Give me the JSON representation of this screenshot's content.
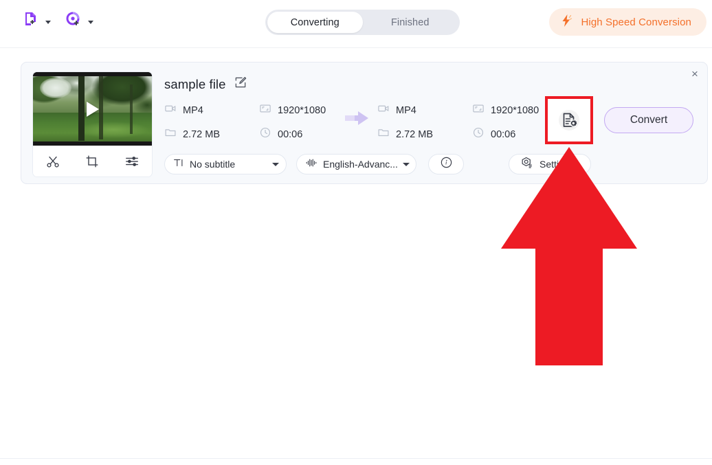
{
  "header": {
    "add_file_icon": "add-file-icon",
    "add_record_icon": "add-record-icon",
    "tabs": [
      {
        "label": "Converting",
        "active": true
      },
      {
        "label": "Finished",
        "active": false
      }
    ],
    "high_speed": {
      "label": "High Speed Conversion",
      "icon": "lightning-bolt-icon",
      "color": "#f4702a",
      "bg": "#fdeee4"
    }
  },
  "card": {
    "close_label": "×",
    "file_name": "sample file",
    "edit_icon": "edit-pencil-icon",
    "thumbnail": {
      "play_icon": "play-icon",
      "tools": [
        {
          "name": "trim-scissors-icon",
          "label": "Trim"
        },
        {
          "name": "crop-icon",
          "label": "Crop"
        },
        {
          "name": "effects-sliders-icon",
          "label": "Effects"
        }
      ]
    },
    "source": {
      "format_icon": "video-camera-icon",
      "format": "MP4",
      "resolution_icon": "resolution-icon",
      "resolution": "1920*1080",
      "size_icon": "folder-icon",
      "size": "2.72 MB",
      "duration_icon": "clock-icon",
      "duration": "00:06"
    },
    "arrow_icon": "convert-arrow-icon",
    "target": {
      "format_icon": "video-camera-icon",
      "format": "MP4",
      "resolution_icon": "resolution-icon",
      "resolution": "1920*1080",
      "size_icon": "folder-icon",
      "size": "2.72 MB",
      "duration_icon": "clock-icon",
      "duration": "00:06"
    },
    "output_settings_icon": "document-gear-icon",
    "convert_label": "Convert",
    "controls": {
      "subtitle": {
        "icon": "subtitle-text-icon",
        "label": "No subtitle",
        "caret": "chevron-down-icon"
      },
      "audio": {
        "icon": "audio-waveform-icon",
        "label": "English-Advanc...",
        "caret": "chevron-down-icon"
      },
      "info": {
        "icon": "info-circle-icon"
      },
      "settings": {
        "icon": "settings-gear-icon",
        "label": "Settings"
      }
    }
  },
  "annotation": {
    "highlight_color": "#ed1b24",
    "arrow_icon": "up-arrow-annotation"
  }
}
